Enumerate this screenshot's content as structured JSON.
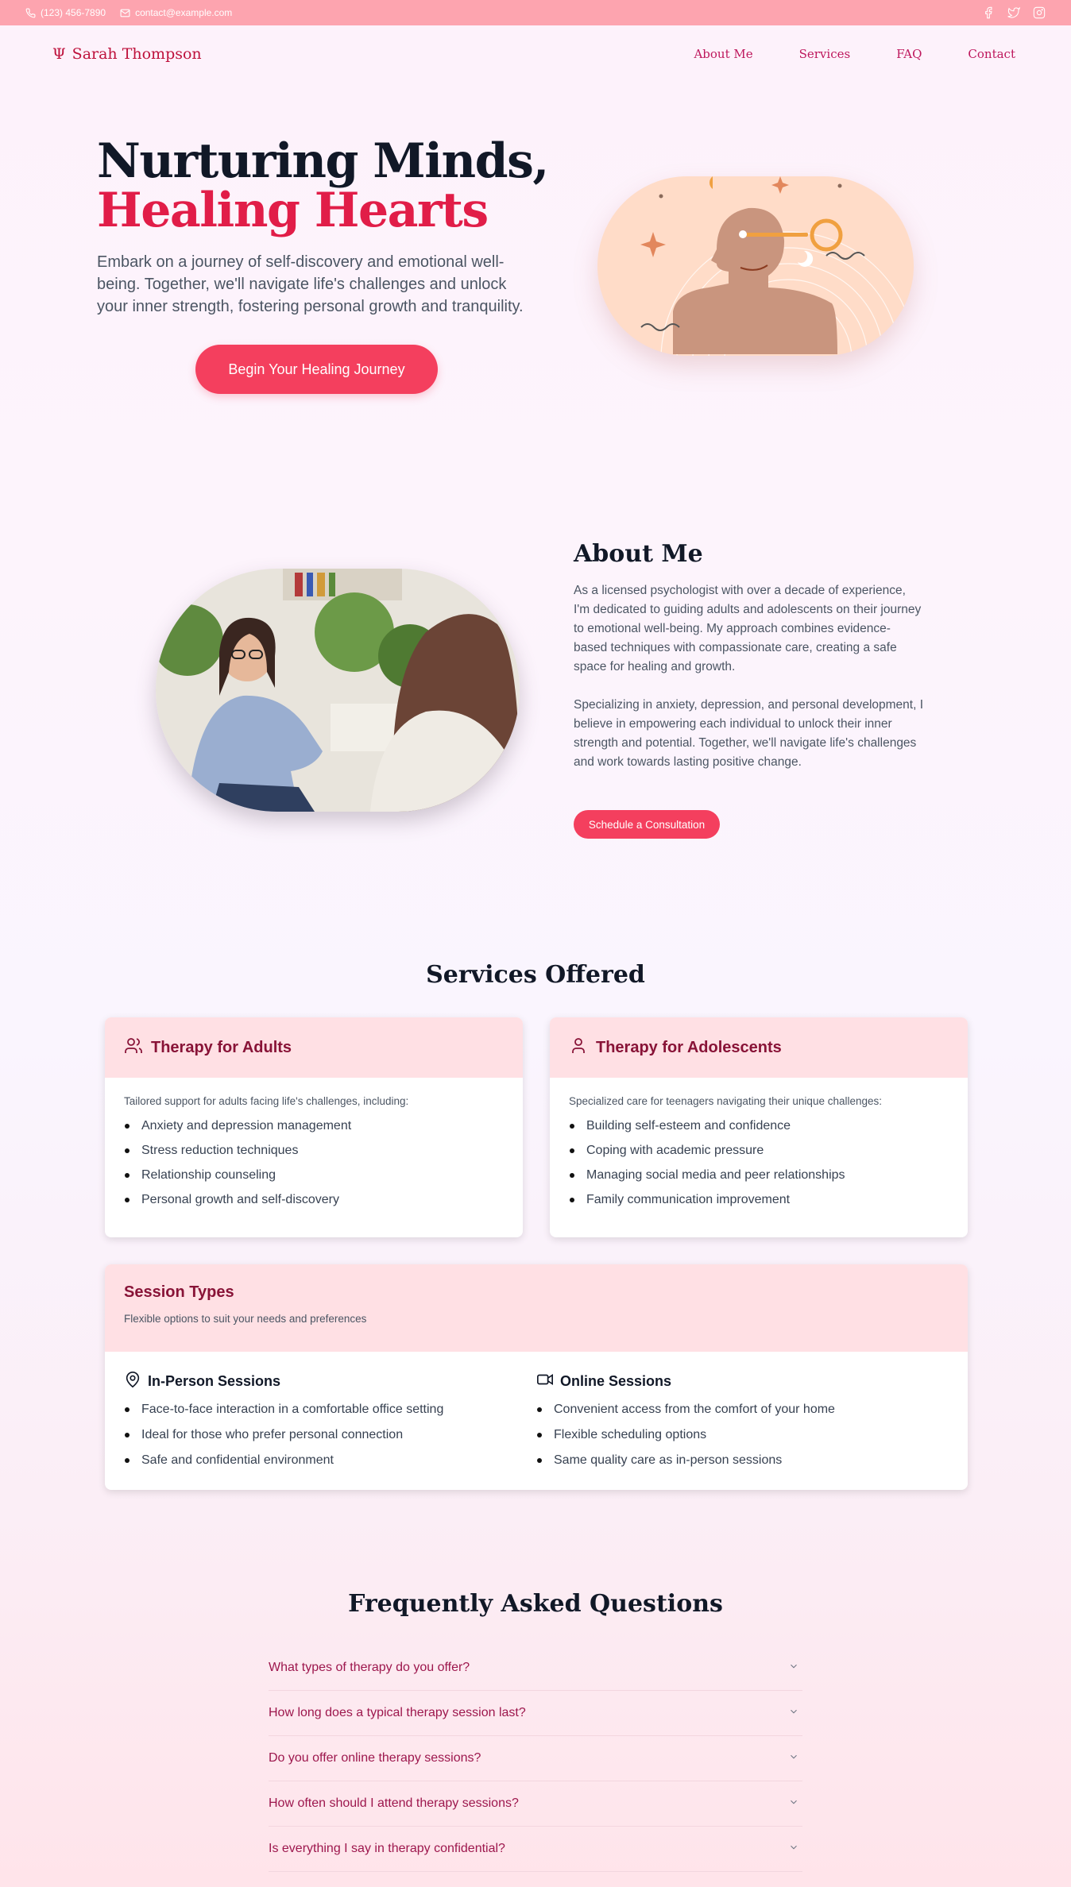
{
  "topbar": {
    "phone": "(123) 456-7890",
    "email": "contact@example.com",
    "social_icons": [
      "facebook-icon",
      "twitter-icon",
      "instagram-icon"
    ]
  },
  "nav": {
    "brand_symbol": "Ψ",
    "brand_name": "Sarah Thompson",
    "links": [
      "About Me",
      "Services",
      "FAQ",
      "Contact"
    ]
  },
  "hero": {
    "title_line1": "Nurturing Minds,",
    "title_line2": "Healing Hearts",
    "text": "Embark on a journey of self-discovery and emotional well-being. Together, we'll navigate life's challenges and unlock your inner strength, fostering personal growth and tranquility.",
    "button": "Begin Your Healing Journey"
  },
  "about": {
    "title": "About Me",
    "p1": "As a licensed psychologist with over a decade of experience, I'm dedicated to guiding adults and adolescents on their journey to emotional well-being. My approach combines evidence-based techniques with compassionate care, creating a safe space for healing and growth.",
    "p2": "Specializing in anxiety, depression, and personal development, I believe in empowering each individual to unlock their inner strength and potential. Together, we'll navigate life's challenges and work towards lasting positive change.",
    "button": "Schedule a Consultation"
  },
  "services": {
    "title": "Services Offered",
    "adults": {
      "title": "Therapy for Adults",
      "desc": "Tailored support for adults facing life's challenges, including:",
      "items": [
        "Anxiety and depression management",
        "Stress reduction techniques",
        "Relationship counseling",
        "Personal growth and self-discovery"
      ]
    },
    "adolescents": {
      "title": "Therapy for Adolescents",
      "desc": "Specialized care for teenagers navigating their unique challenges:",
      "items": [
        "Building self-esteem and confidence",
        "Coping with academic pressure",
        "Managing social media and peer relationships",
        "Family communication improvement"
      ]
    },
    "sessions": {
      "title": "Session Types",
      "desc": "Flexible options to suit your needs and preferences",
      "in_person": {
        "title": "In-Person Sessions",
        "items": [
          "Face-to-face interaction in a comfortable office setting",
          "Ideal for those who prefer personal connection",
          "Safe and confidential environment"
        ]
      },
      "online": {
        "title": "Online Sessions",
        "items": [
          "Convenient access from the comfort of your home",
          "Flexible scheduling options",
          "Same quality care as in-person sessions"
        ]
      }
    }
  },
  "faq": {
    "title": "Frequently Asked Questions",
    "items": [
      "What types of therapy do you offer?",
      "How long does a typical therapy session last?",
      "Do you offer online therapy sessions?",
      "How often should I attend therapy sessions?",
      "Is everything I say in therapy confidential?"
    ]
  },
  "colors": {
    "accent": "#f43f5e",
    "brand": "#be123c",
    "topbar": "#fda4af",
    "card_header": "#ffe0e4"
  }
}
